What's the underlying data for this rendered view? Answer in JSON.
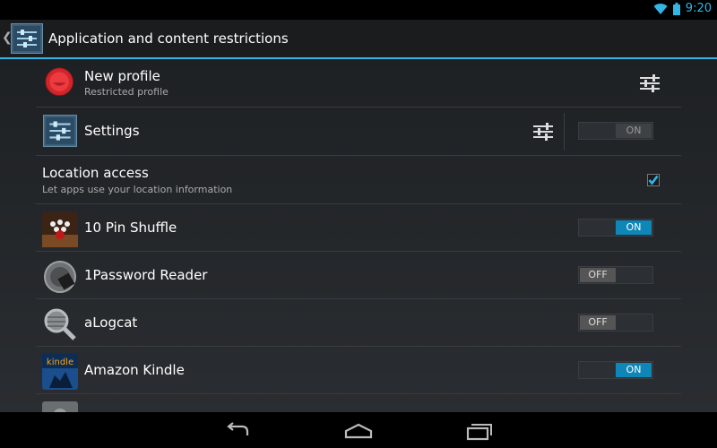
{
  "status_bar": {
    "time": "9:20",
    "wifi_icon": "wifi-icon",
    "battery_icon": "battery-icon"
  },
  "action_bar": {
    "title": "Application and content restrictions",
    "icon": "restrictions-settings-icon"
  },
  "colors": {
    "accent": "#33b5e5",
    "toggle_on": "#0f86b8",
    "toggle_off": "#555555"
  },
  "rows": {
    "profile": {
      "title": "New profile",
      "subtitle": "Restricted profile"
    },
    "settings": {
      "title": "Settings",
      "toggle": "ON"
    },
    "location": {
      "title": "Location access",
      "subtitle": "Let apps use your location information",
      "checked": true
    },
    "apps": [
      {
        "name": "10 Pin Shuffle",
        "toggle": "ON"
      },
      {
        "name": "1Password Reader",
        "toggle": "OFF"
      },
      {
        "name": "aLogcat",
        "toggle": "OFF"
      },
      {
        "name": "Amazon Kindle",
        "toggle": "ON",
        "icon_text": "kindle"
      }
    ]
  },
  "nav_bar": {
    "back_icon": "back-icon",
    "home_icon": "home-icon",
    "recents_icon": "recents-icon"
  }
}
